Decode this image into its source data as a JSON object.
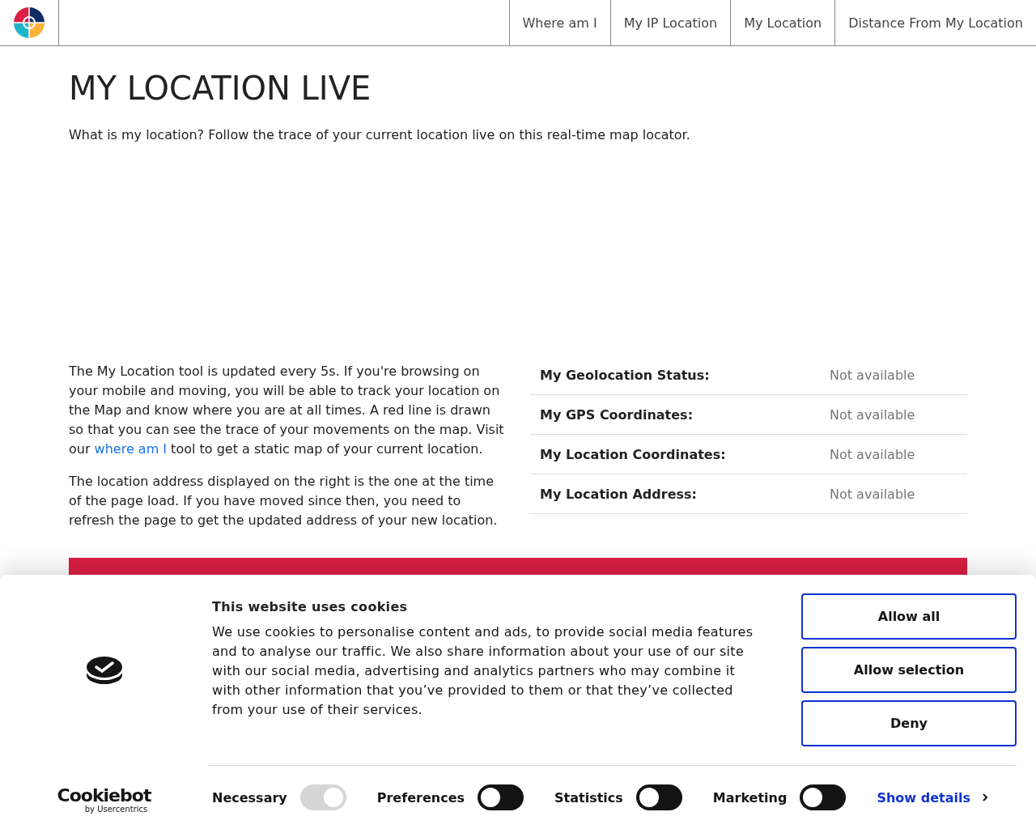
{
  "nav": {
    "items": [
      {
        "label": "Where am I",
        "selected": false
      },
      {
        "label": "My IP Location",
        "selected": false
      },
      {
        "label": "My Location",
        "selected": false
      },
      {
        "label": "Distance From My Location",
        "selected": false
      }
    ]
  },
  "title": "MY LOCATION LIVE",
  "intro": "What is my location? Follow the trace of your current location live on this real-time map locator.",
  "paragraphs": [
    {
      "before": "The My Location tool is updated every 5s. If you're browsing on your mobile and moving, you will be able to track your location on the Map and know where you are at all times. A red line is drawn so that you can see the trace of your movements on the map. Visit our ",
      "link": "where am I",
      "after": " tool to get a static map of your current location."
    },
    {
      "before": "The location address displayed on the right is the one at the time of the page load. If you have moved since then, you need to refresh the page to get the updated address of your new location."
    }
  ],
  "info_table": [
    {
      "label": "My Geolocation Status:",
      "value": "Not available"
    },
    {
      "label": "My GPS Coordinates:",
      "value": "Not available"
    },
    {
      "label": "My Location Coordinates:",
      "value": "Not available"
    },
    {
      "label": "My Location Address:",
      "value": "Not available"
    }
  ],
  "cookie_banner": {
    "brand": "Cookiebot",
    "brand_sub": "by Usercentrics",
    "title": "This website uses cookies",
    "text": "We use cookies to personalise content and ads, to provide social media features and to analyse our traffic. We also share information about your use of our site with our social media, advertising and analytics partners who may combine it with other information that you’ve provided to them or that they’ve collected from your use of their services.",
    "buttons": [
      "Allow all",
      "Allow selection",
      "Deny"
    ],
    "toggles": [
      {
        "label": "Necessary",
        "on": true,
        "disabled": true
      },
      {
        "label": "Preferences",
        "on": false,
        "disabled": false
      },
      {
        "label": "Statistics",
        "on": false,
        "disabled": false
      },
      {
        "label": "Marketing",
        "on": false,
        "disabled": false
      }
    ],
    "details_link": "Show details"
  }
}
